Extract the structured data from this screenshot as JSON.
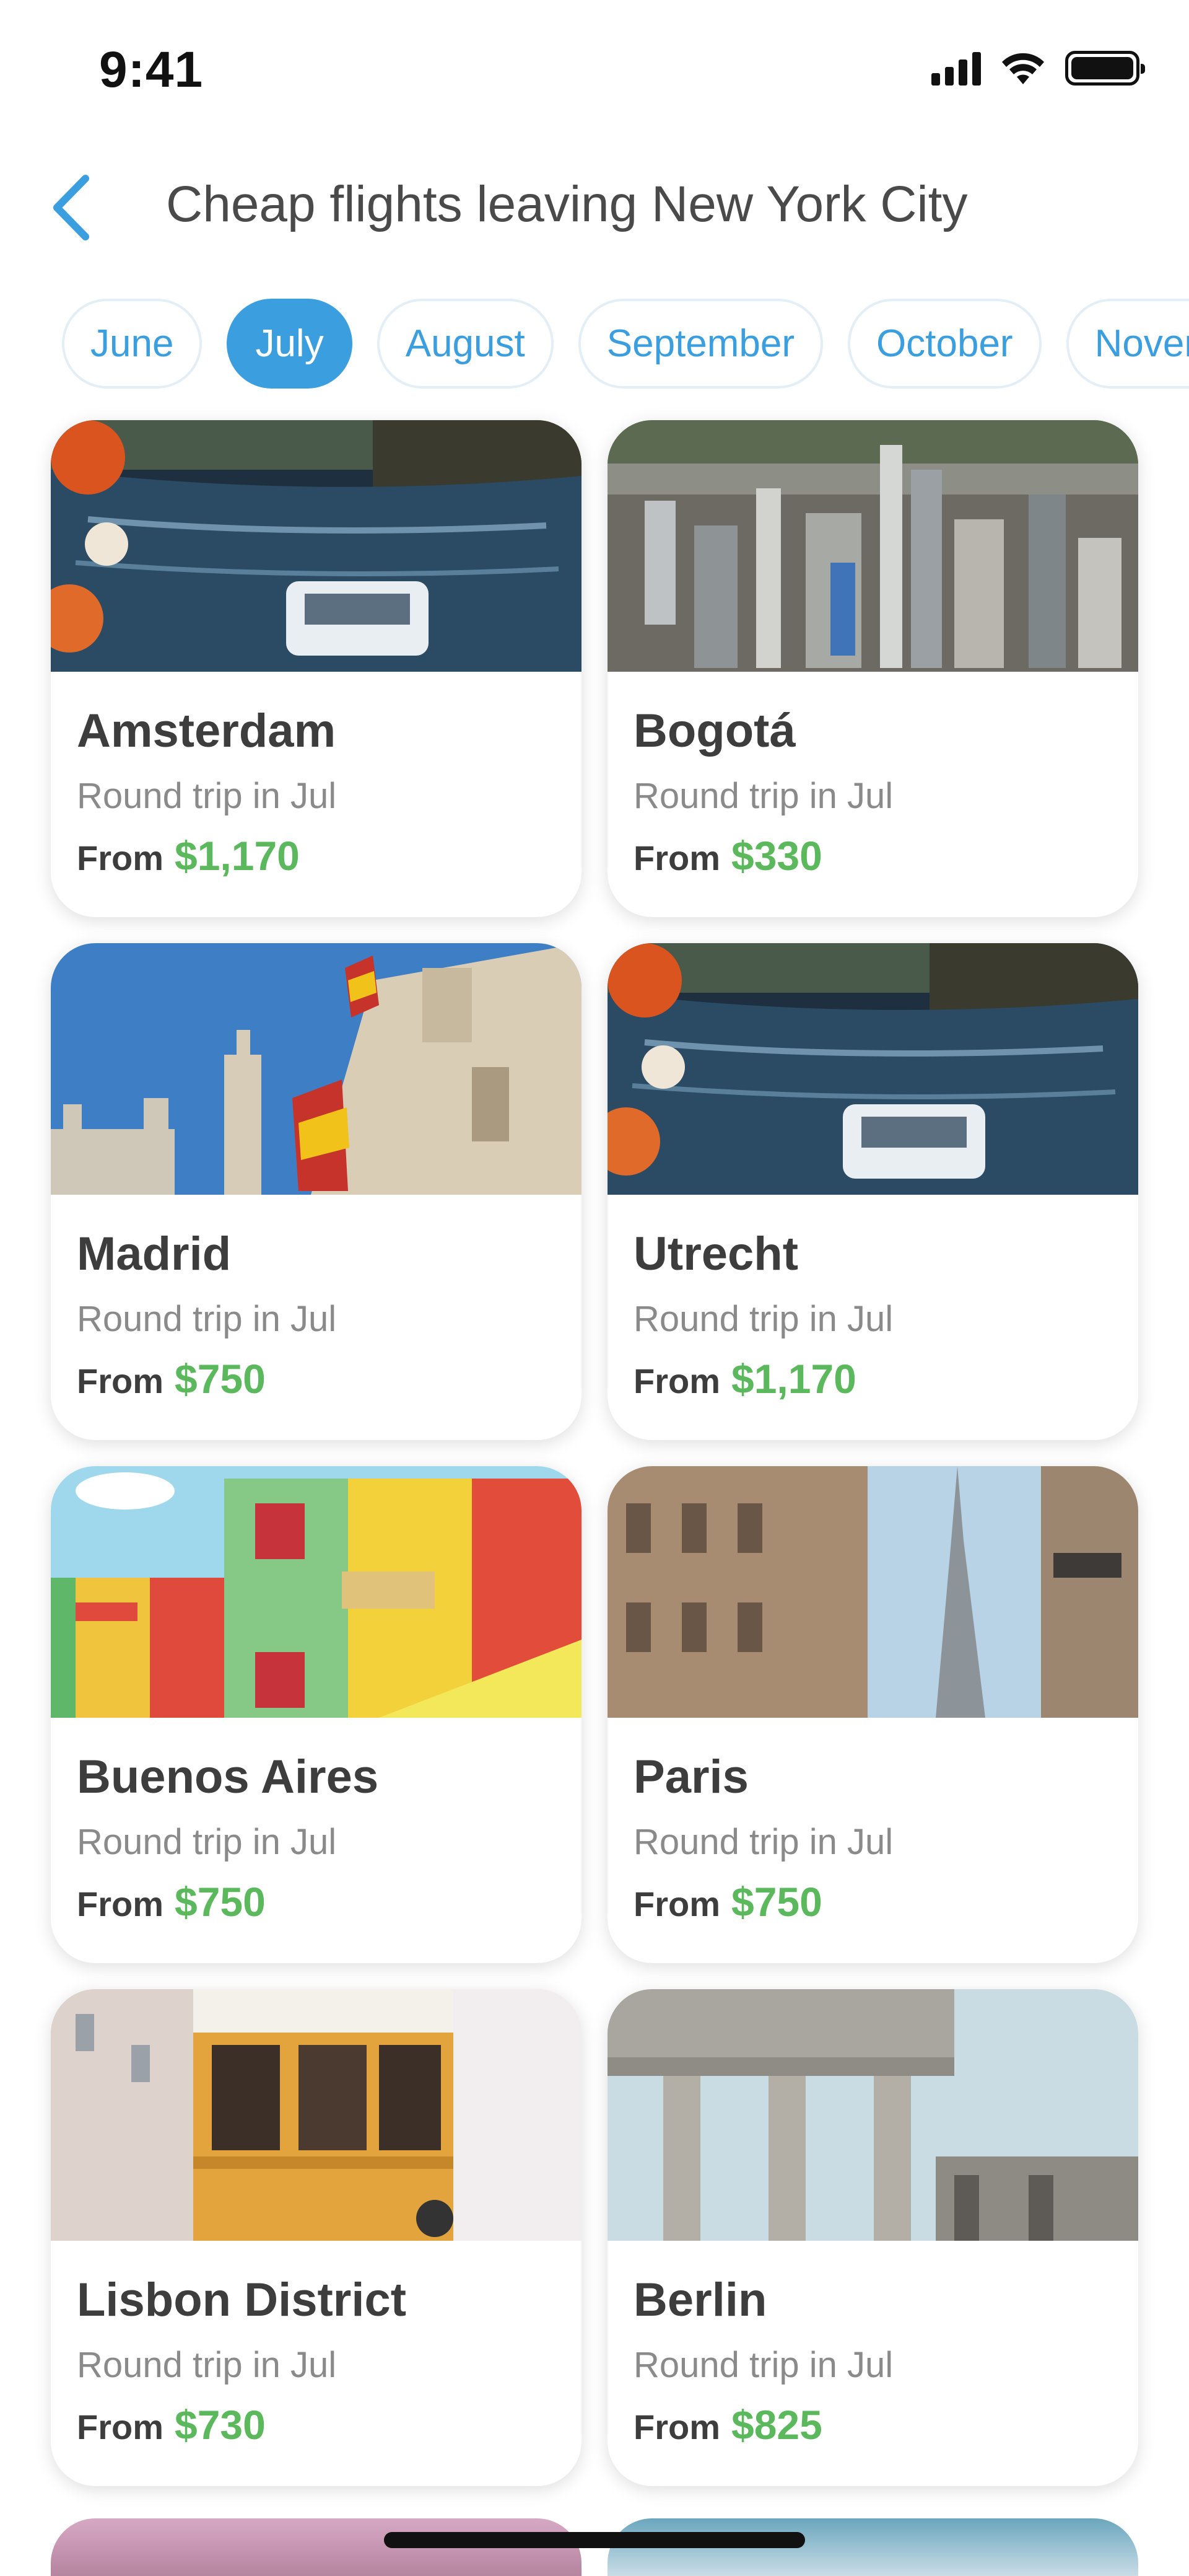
{
  "status_bar": {
    "time": "9:41"
  },
  "header": {
    "title": "Cheap flights leaving New York City"
  },
  "months": [
    "June",
    "July",
    "August",
    "September",
    "October",
    "November"
  ],
  "active_month": "July",
  "cards": [
    {
      "city": "Amsterdam",
      "subtitle": "Round trip in Jul",
      "from_label": "From",
      "price": "$1,170",
      "image": "canal-photo"
    },
    {
      "city": "Bogotá",
      "subtitle": "Round trip in Jul",
      "from_label": "From",
      "price": "$330",
      "image": "city-skyline-photo"
    },
    {
      "city": "Madrid",
      "subtitle": "Round trip in Jul",
      "from_label": "From",
      "price": "$750",
      "image": "palace-flag-photo"
    },
    {
      "city": "Utrecht",
      "subtitle": "Round trip in Jul",
      "from_label": "From",
      "price": "$1,170",
      "image": "canal-photo"
    },
    {
      "city": "Buenos Aires",
      "subtitle": "Round trip in Jul",
      "from_label": "From",
      "price": "$750",
      "image": "colorful-houses-photo"
    },
    {
      "city": "Paris",
      "subtitle": "Round trip in Jul",
      "from_label": "From",
      "price": "$750",
      "image": "eiffel-tower-photo"
    },
    {
      "city": "Lisbon District",
      "subtitle": "Round trip in Jul",
      "from_label": "From",
      "price": "$730",
      "image": "tram-photo"
    },
    {
      "city": "Berlin",
      "subtitle": "Round trip in Jul",
      "from_label": "From",
      "price": "$825",
      "image": "brandenburg-gate-photo"
    }
  ],
  "colors": {
    "accent": "#3b9ede",
    "price": "#5cb85c",
    "title": "#4a4a4a",
    "subtitle": "#8a8a8a"
  },
  "icons": {
    "back": "chevron-left-icon",
    "signal": "cellular-signal-icon",
    "wifi": "wifi-icon",
    "battery": "battery-icon"
  }
}
